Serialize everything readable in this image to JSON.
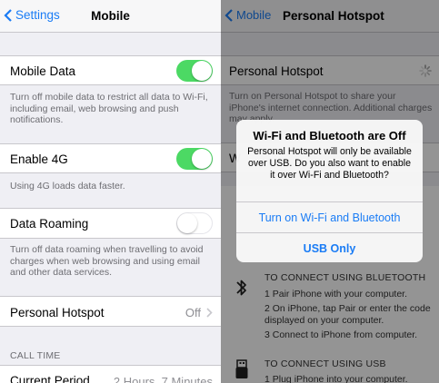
{
  "left": {
    "nav": {
      "back_label": "Settings",
      "title": "Mobile"
    },
    "mobile_data": {
      "label": "Mobile Data",
      "on": true,
      "note": "Turn off mobile data to restrict all data to Wi-Fi, including email, web browsing and push notifications."
    },
    "enable_4g": {
      "label": "Enable 4G",
      "on": true,
      "note": "Using 4G loads data faster."
    },
    "data_roaming": {
      "label": "Data Roaming",
      "on": false,
      "note": "Turn off data roaming when travelling to avoid charges when web browsing and using email and other data services."
    },
    "personal_hotspot": {
      "label": "Personal Hotspot",
      "value": "Off"
    },
    "call_time": {
      "header": "CALL TIME",
      "current_period_label": "Current Period",
      "current_period_value": "2 Hours, 7 Minutes"
    }
  },
  "right": {
    "nav": {
      "back_label": "Mobile",
      "title": "Personal Hotspot"
    },
    "hotspot_cell_label": "Personal Hotspot",
    "hotspot_note": "Turn on Personal Hotspot to share your iPhone's internet connection. Additional charges may apply.",
    "wifi_row_partial": "W",
    "bluetooth": {
      "header": "TO CONNECT USING BLUETOOTH",
      "step1": "1 Pair iPhone with your computer.",
      "step2": "2 On iPhone, tap Pair or enter the code displayed on your computer.",
      "step3": "3 Connect to iPhone from computer."
    },
    "usb": {
      "header": "TO CONNECT USING USB",
      "step1": "1 Plug iPhone into your computer."
    }
  },
  "alert": {
    "title": "Wi-Fi and Bluetooth are Off",
    "message": "Personal Hotspot will only be available over USB. Do you also want to enable it over Wi-Fi and Bluetooth?",
    "button_primary": "Turn on Wi-Fi and Bluetooth",
    "button_secondary": "USB Only"
  },
  "colors": {
    "accent": "#1a7cf5",
    "toggle_on": "#4cd964",
    "background": "#efeff4",
    "dim_overlay": "rgba(0,0,0,0.42)"
  },
  "icons": [
    "chevron-left-icon",
    "chevron-right-icon",
    "bluetooth-icon",
    "usb-icon",
    "spinner-icon"
  ]
}
